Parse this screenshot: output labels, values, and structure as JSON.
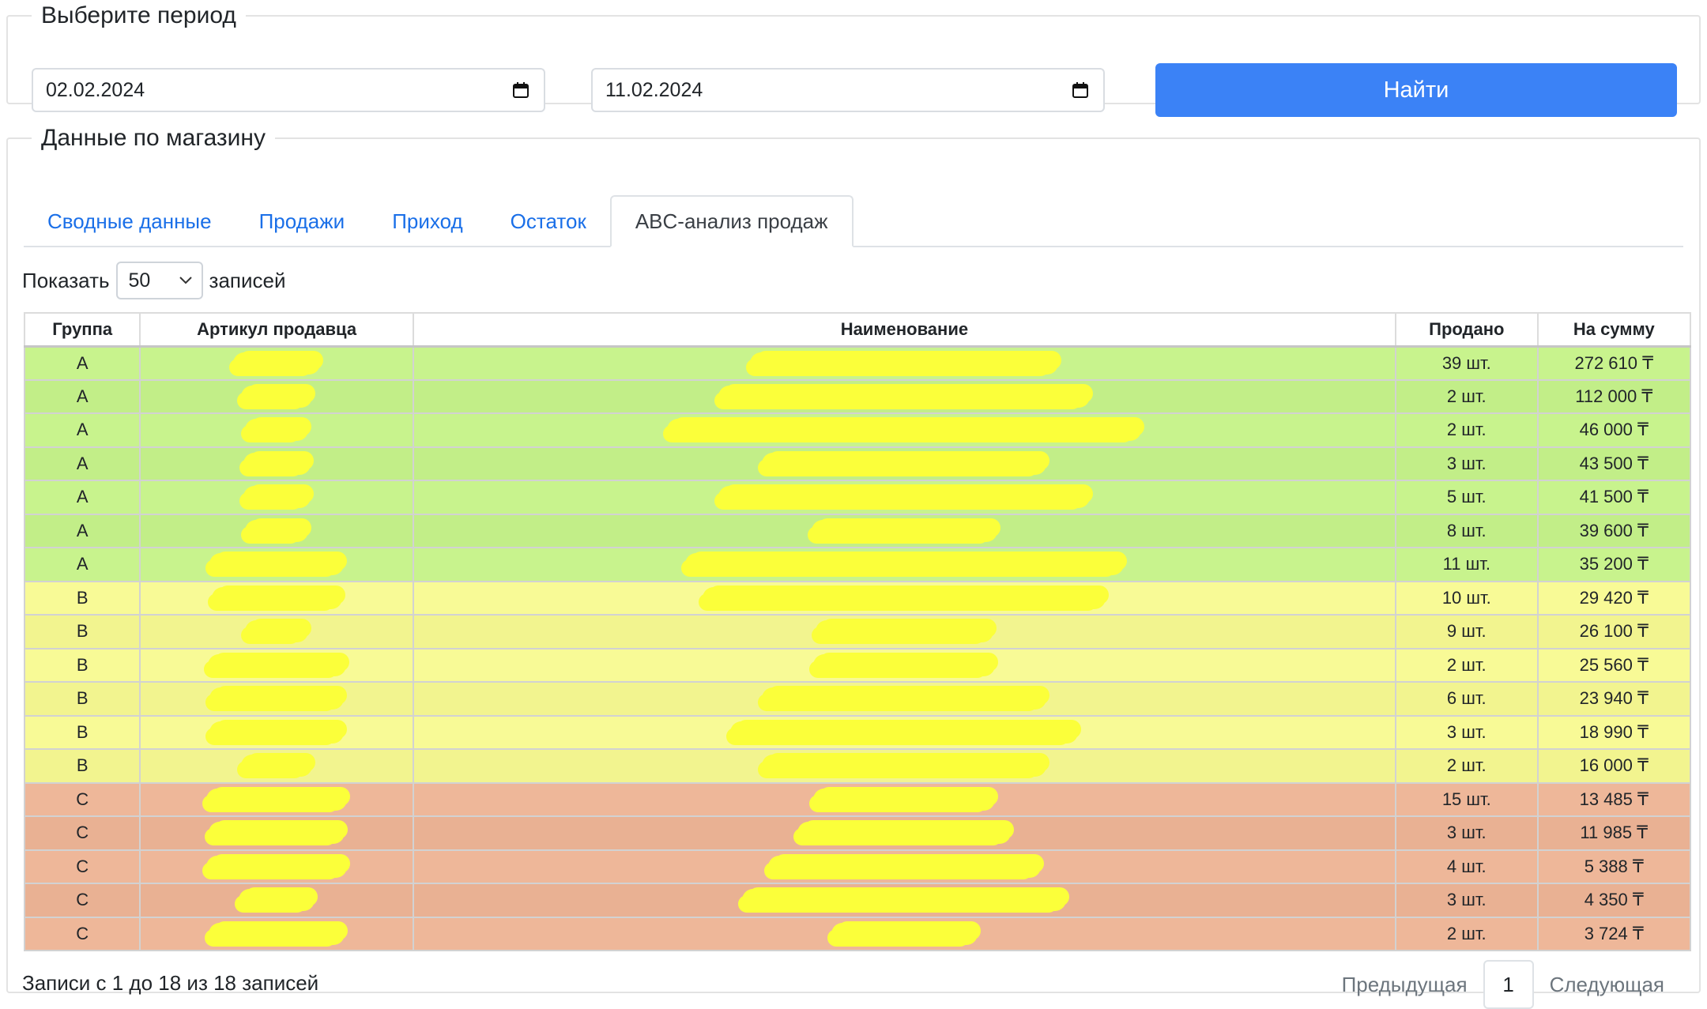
{
  "period": {
    "legend": "Выберите период",
    "date_from": "02.02.2024",
    "date_to": "11.02.2024",
    "find_label": "Найти"
  },
  "store": {
    "legend": "Данные по магазину",
    "tabs": [
      "Сводные данные",
      "Продажи",
      "Приход",
      "Остаток",
      "ABC-анализ продаж"
    ],
    "active_tab": 4
  },
  "length_control": {
    "prefix": "Показать",
    "value": "50",
    "suffix": "записей"
  },
  "table": {
    "columns": [
      "Группа",
      "Артикул продавца",
      "Наименование",
      "Продано",
      "На сумму"
    ],
    "rows": [
      {
        "group": "A",
        "sold": "39 шт.",
        "sum": "272 610 ₸"
      },
      {
        "group": "A",
        "sold": "2 шт.",
        "sum": "112 000 ₸"
      },
      {
        "group": "A",
        "sold": "2 шт.",
        "sum": "46 000 ₸"
      },
      {
        "group": "A",
        "sold": "3 шт.",
        "sum": "43 500 ₸"
      },
      {
        "group": "A",
        "sold": "5 шт.",
        "sum": "41 500 ₸"
      },
      {
        "group": "A",
        "sold": "8 шт.",
        "sum": "39 600 ₸"
      },
      {
        "group": "A",
        "sold": "11 шт.",
        "sum": "35 200 ₸"
      },
      {
        "group": "B",
        "sold": "10 шт.",
        "sum": "29 420 ₸"
      },
      {
        "group": "B",
        "sold": "9 шт.",
        "sum": "26 100 ₸"
      },
      {
        "group": "B",
        "sold": "2 шт.",
        "sum": "25 560 ₸"
      },
      {
        "group": "B",
        "sold": "6 шт.",
        "sum": "23 940 ₸"
      },
      {
        "group": "B",
        "sold": "3 шт.",
        "sum": "18 990 ₸"
      },
      {
        "group": "B",
        "sold": "2 шт.",
        "sum": "16 000 ₸"
      },
      {
        "group": "C",
        "sold": "15 шт.",
        "sum": "13 485 ₸"
      },
      {
        "group": "C",
        "sold": "3 шт.",
        "sum": "11 985 ₸"
      },
      {
        "group": "C",
        "sold": "4 шт.",
        "sum": "5 388 ₸"
      },
      {
        "group": "C",
        "sold": "3 шт.",
        "sum": "4 350 ₸"
      },
      {
        "group": "C",
        "sold": "2 шт.",
        "sum": "3 724 ₸"
      }
    ]
  },
  "footer": {
    "info": "Записи с 1 до 18 из 18 записей",
    "prev": "Предыдущая",
    "page": "1",
    "next": "Следующая"
  },
  "colors": {
    "primary": "#3b82f6",
    "link": "#1a6fe8",
    "group_a": "#c8f38d",
    "group_b": "#f8fa96",
    "group_c": "#eeb799",
    "redaction": "#fbff3a"
  },
  "icons": {
    "date_picker": "calendar-icon",
    "select": "chevron-down-icon"
  }
}
